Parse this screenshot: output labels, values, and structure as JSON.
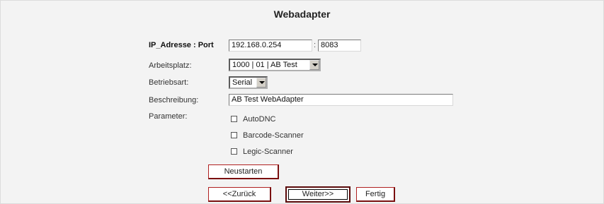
{
  "page": {
    "title": "Webadapter"
  },
  "form": {
    "ip_label": "IP_Adresse : Port",
    "ip_value": "192.168.0.254",
    "port_sep": ":",
    "port_value": "8083",
    "arbeitsplatz_label": "Arbeitsplatz:",
    "arbeitsplatz_value": "1000 | 01 | AB Test",
    "betriebsart_label": "Betriebsart:",
    "betriebsart_value": "Serial",
    "beschreibung_label": "Beschreibung:",
    "beschreibung_value": "AB Test WebAdapter",
    "parameter_label": "Parameter:",
    "params": [
      {
        "label": "AutoDNC",
        "checked": false
      },
      {
        "label": "Barcode-Scanner",
        "checked": false
      },
      {
        "label": "Legic-Scanner",
        "checked": false
      }
    ]
  },
  "buttons": {
    "neustarten": "Neustarten",
    "zurueck": "<<Zurück",
    "weiter": "Weiter>>",
    "fertig": "Fertig"
  },
  "colors": {
    "button_border": "#b02020",
    "background": "#f3f3f3"
  },
  "icons": {
    "dropdown": "chevron-down-icon",
    "checkbox": "checkbox-unchecked"
  }
}
